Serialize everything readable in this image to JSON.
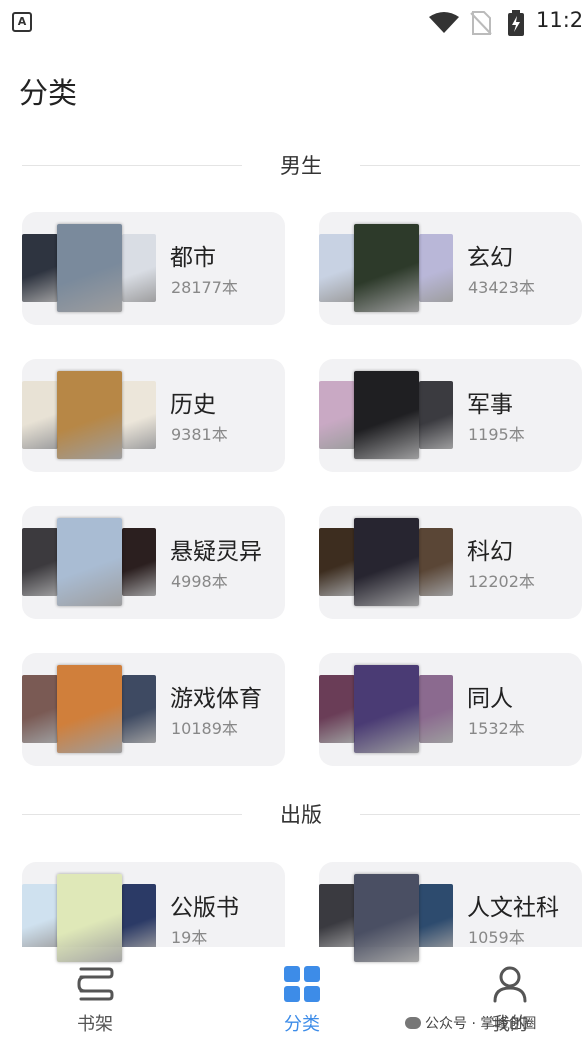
{
  "status_bar": {
    "app_badge": "A",
    "time": "11:2"
  },
  "page_title": "分类",
  "sections": [
    {
      "title": "男生",
      "categories": [
        {
          "name": "都市",
          "count": "28177本",
          "colors": [
            "#2e3440",
            "#7a8a9c",
            "#d9dde4"
          ]
        },
        {
          "name": "玄幻",
          "count": "43423本",
          "colors": [
            "#c8d2e3",
            "#2d3a2a",
            "#b9b7d8"
          ]
        },
        {
          "name": "历史",
          "count": "9381本",
          "colors": [
            "#e8e2d5",
            "#b78746",
            "#ece6da"
          ]
        },
        {
          "name": "军事",
          "count": "1195本",
          "colors": [
            "#c9a9c4",
            "#1f1f22",
            "#3b3b40"
          ]
        },
        {
          "name": "悬疑灵异",
          "count": "4998本",
          "colors": [
            "#3c3a3e",
            "#a9bcd3",
            "#2b1f1f"
          ]
        },
        {
          "name": "科幻",
          "count": "12202本",
          "colors": [
            "#3d2d1f",
            "#272530",
            "#5a4636"
          ]
        },
        {
          "name": "游戏体育",
          "count": "10189本",
          "colors": [
            "#7a5a54",
            "#d07f3b",
            "#3e4a62"
          ]
        },
        {
          "name": "同人",
          "count": "1532本",
          "colors": [
            "#6a3d57",
            "#4a3b74",
            "#8b6a8f"
          ]
        }
      ]
    },
    {
      "title": "出版",
      "categories": [
        {
          "name": "公版书",
          "count": "19本",
          "colors": [
            "#cfe1ef",
            "#dfe8b8",
            "#2b3a66"
          ]
        },
        {
          "name": "人文社科",
          "count": "1059本",
          "colors": [
            "#3a3a40",
            "#4a4f63",
            "#2d4b6e"
          ]
        }
      ]
    }
  ],
  "bottom_nav": [
    {
      "label": "书架",
      "icon": "bookshelf-icon",
      "active": false
    },
    {
      "label": "分类",
      "icon": "category-grid-icon",
      "active": true
    },
    {
      "label": "我的",
      "icon": "user-icon",
      "active": false
    }
  ],
  "watermark": "公众号 · 掌峰创圈",
  "colors": {
    "accent": "#3d8ce8",
    "card_bg": "#f2f2f4"
  }
}
